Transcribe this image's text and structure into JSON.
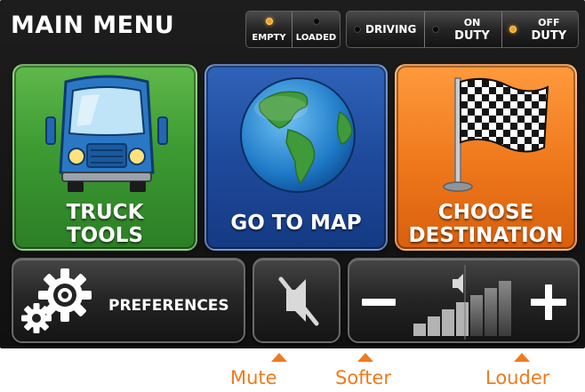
{
  "header": {
    "title": "MAIN MENU"
  },
  "load_status": {
    "empty_label": "EMPTY",
    "loaded_label": "LOADED",
    "active": "EMPTY"
  },
  "duty_status": {
    "driving_label": "DRIVING",
    "on_duty_line1": "ON",
    "on_duty_line2": "DUTY",
    "off_duty_line1": "OFF",
    "off_duty_line2": "DUTY",
    "active": "OFF DUTY"
  },
  "tiles": {
    "truck_tools_line1": "TRUCK",
    "truck_tools_line2": "TOOLS",
    "go_to_map": "GO TO MAP",
    "choose_destination_line1": "CHOOSE",
    "choose_destination_line2": "DESTINATION"
  },
  "bottom_bar": {
    "preferences_label": "PREFERENCES"
  },
  "annotations": {
    "mute": "Mute",
    "softer": "Softer",
    "louder": "Louder"
  },
  "colors": {
    "accent": "#f07a1e",
    "truck_tile": "#3d9b33",
    "map_tile": "#1f4a9c",
    "destination_tile": "#f07a1e",
    "status_on": "#f2a21c"
  },
  "icons": {
    "truck_tools": "truck-icon",
    "go_to_map": "globe-icon",
    "choose_destination": "checkered-flag-icon",
    "preferences": "gears-icon",
    "mute": "speaker-muted-icon",
    "softer": "minus-icon",
    "louder": "plus-icon",
    "volume": "volume-level-icon"
  }
}
